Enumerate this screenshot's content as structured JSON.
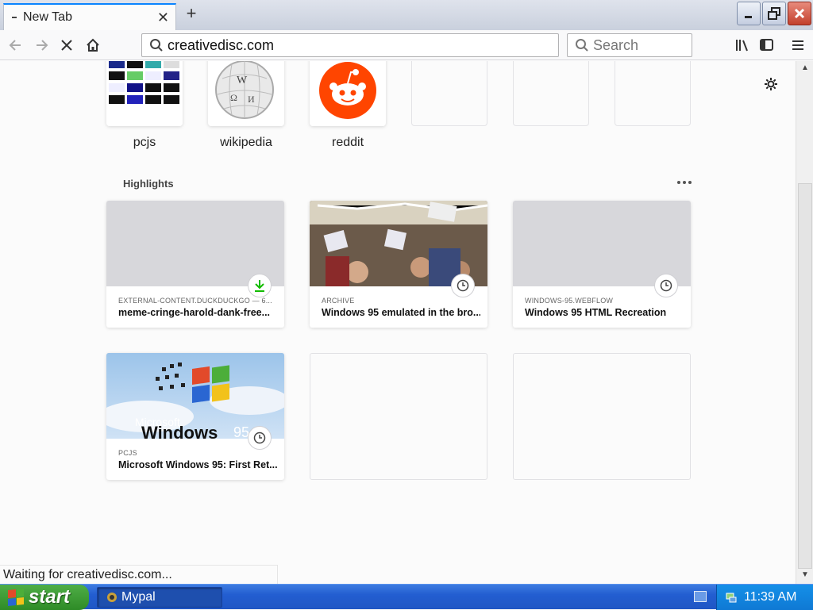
{
  "tab": {
    "title": "New Tab"
  },
  "nav": {
    "url": "creativedisc.com",
    "search_placeholder": "Search"
  },
  "top_sites": [
    {
      "label": "pcjs"
    },
    {
      "label": "wikipedia"
    },
    {
      "label": "reddit"
    },
    {
      "label": ""
    },
    {
      "label": ""
    },
    {
      "label": ""
    }
  ],
  "highlights": {
    "title": "Highlights",
    "cards": [
      {
        "source": "EXTERNAL-CONTENT.DUCKDUCKGO — 6...",
        "title": "meme-cringe-harold-dank-free...",
        "badge": "download-icon"
      },
      {
        "source": "ARCHIVE",
        "title": "Windows 95 emulated in the bro...",
        "badge": "clock-icon"
      },
      {
        "source": "WINDOWS-95.WEBFLOW",
        "title": "Windows 95 HTML Recreation",
        "badge": "clock-icon"
      },
      {
        "source": "PCJS",
        "title": "Microsoft Windows 95: First Ret...",
        "badge": "clock-icon"
      }
    ]
  },
  "status_text": "Waiting for creativedisc.com...",
  "taskbar": {
    "start_label": "start",
    "task_label": "Mypal",
    "clock": "11:39 AM"
  },
  "colors": {
    "accent": "#0a84ff",
    "reddit": "#ff4500",
    "taskbar": "#235ed1",
    "start": "#2e8b27"
  }
}
